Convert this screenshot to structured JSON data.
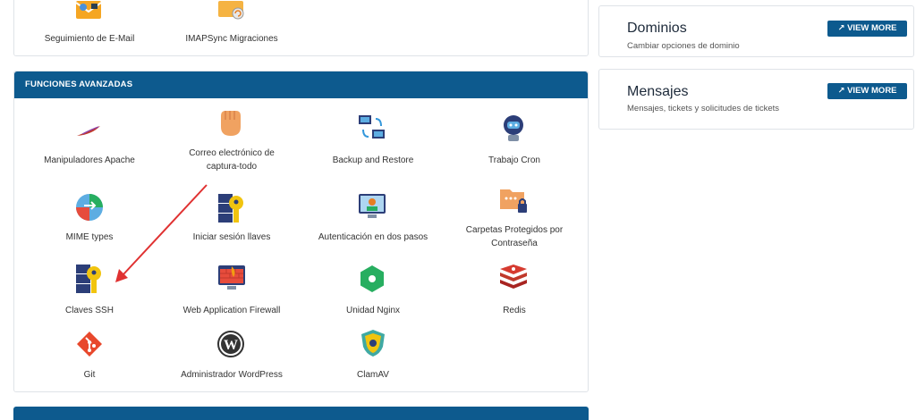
{
  "top_tiles": [
    {
      "label": "Seguimiento de E-Mail"
    },
    {
      "label": "IMAPSync Migraciones"
    }
  ],
  "advanced": {
    "header": "FUNCIONES AVANZADAS",
    "tiles": [
      {
        "label": "Manipuladores Apache"
      },
      {
        "label_line1": "Correo electrónico de",
        "label_line2": "captura-todo"
      },
      {
        "label": "Backup and Restore"
      },
      {
        "label": "Trabajo Cron"
      },
      {
        "label": "MIME types"
      },
      {
        "label": "Iniciar sesión llaves"
      },
      {
        "label": "Autenticación en dos pasos"
      },
      {
        "label_line1": "Carpetas Protegidos por",
        "label_line2": "Contraseña"
      },
      {
        "label": "Claves SSH"
      },
      {
        "label": "Web Application Firewall"
      },
      {
        "label": "Unidad Nginx"
      },
      {
        "label": "Redis"
      },
      {
        "label": "Git"
      },
      {
        "label": "Administrador WordPress"
      },
      {
        "label": "ClamAV"
      }
    ]
  },
  "side_cards": [
    {
      "title": "Dominios",
      "subtitle": "Cambiar opciones de dominio",
      "button": "VIEW MORE"
    },
    {
      "title": "Mensajes",
      "subtitle": "Mensajes, tickets y solicitudes de tickets",
      "button": "VIEW MORE"
    }
  ],
  "colors": {
    "header": "#0d5a8e",
    "annotation_arrow": "#e03131"
  }
}
